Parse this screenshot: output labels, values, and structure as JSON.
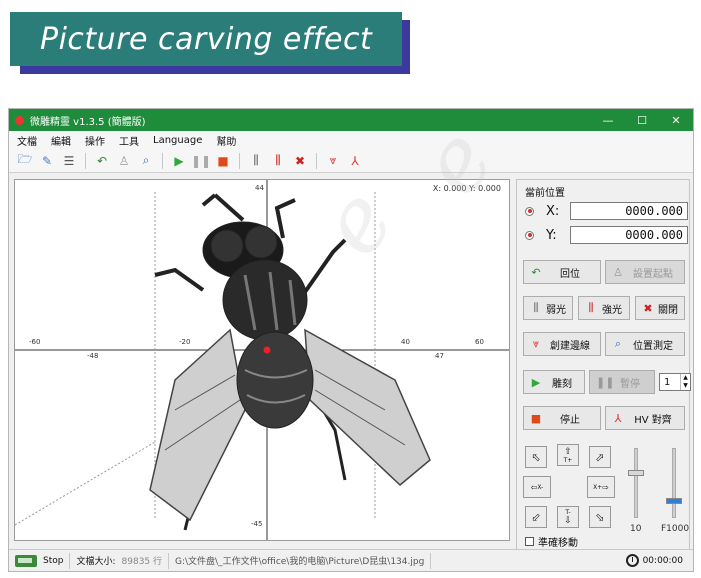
{
  "banner": {
    "title": "Picture carving effect"
  },
  "window": {
    "title": "微雕精靈  v1.3.5 (簡體版)",
    "controls": {
      "minimize": "—",
      "maximize": "☐",
      "close": "✕"
    }
  },
  "menu": [
    "文檔",
    "編輯",
    "操作",
    "工具",
    "Language",
    "幫助"
  ],
  "canvas": {
    "coord_readout": "X: 0.000 Y: 0.000",
    "x_ticks": [
      "-60",
      "-48",
      "-20",
      "40",
      "47",
      "60"
    ],
    "y_ticks": [
      "44",
      "-45"
    ]
  },
  "panel": {
    "title": "當前位置",
    "x_label": "X:",
    "x_value": "0000.000",
    "y_label": "Y:",
    "y_value": "0000.000",
    "home_btn": "回位",
    "set_origin_btn": "設置起點",
    "weak_light_btn": "弱光",
    "strong_light_btn": "強光",
    "close_light_btn": "關閉",
    "create_border_btn": "創建邊線",
    "position_measure_btn": "位置測定",
    "engrave_btn": "雕刻",
    "pause_btn": "暫停",
    "repeat_count": "1",
    "stop_btn": "停止",
    "hv_align_btn": "HV 對齊",
    "jog_t_plus": "T+",
    "jog_t_minus": "T-",
    "jog_x_minus": "X-",
    "jog_x_plus": "X+",
    "slider_left_cap": "10",
    "slider_right_cap": "F1000",
    "fine_move_label": "準確移動"
  },
  "status": {
    "state": "Stop",
    "file_size_label": "文檔大小:",
    "file_size_value": "89835 行",
    "file_path": "G:\\文件盘\\_工作文件\\office\\我的电脑\\Picture\\D昆虫\\134.jpg",
    "timer": "00:00:00"
  }
}
